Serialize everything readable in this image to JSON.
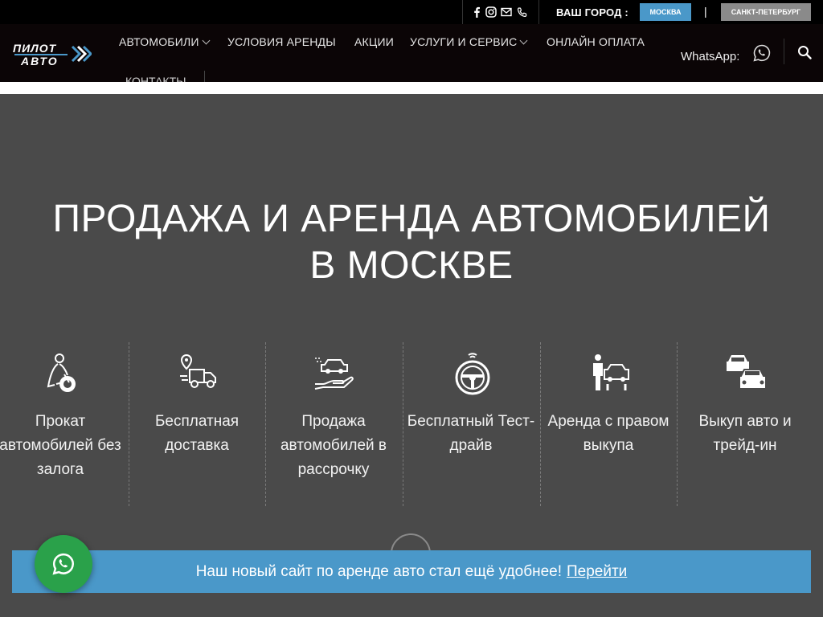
{
  "topbar": {
    "social_icons": [
      "facebook-icon",
      "instagram-icon",
      "mail-icon",
      "phone-icon"
    ],
    "city_label": "ВАШ ГОРОД :",
    "city_moscow": "МОСКВА",
    "city_divider": "|",
    "city_spb": "САНКТ-ПЕТЕРБУРГ"
  },
  "header": {
    "logo_line1": "ПИЛОТ",
    "logo_line2": "АВТО",
    "nav": [
      {
        "label": "АВТОМОБИЛИ",
        "dropdown": true
      },
      {
        "label": "УСЛОВИЯ АРЕНДЫ",
        "dropdown": false
      },
      {
        "label": "АКЦИИ",
        "dropdown": false
      },
      {
        "label": "УСЛУГИ И СЕРВИС",
        "dropdown": true
      },
      {
        "label": "ОНЛАЙН ОПЛАТА",
        "dropdown": false
      },
      {
        "label": "КОНТАКТЫ",
        "dropdown": false
      }
    ],
    "whatsapp_label": "WhatsApp:"
  },
  "hero": {
    "title_line1": "ПРОДАЖА И АРЕНДА АВТОМОБИЛЕЙ",
    "title_line2": "В МОСКВЕ",
    "features": [
      {
        "icon": "driver-icon",
        "text": "Прокат автомобилей без залога"
      },
      {
        "icon": "delivery-truck-icon",
        "text": "Бесплатная доставка"
      },
      {
        "icon": "car-in-hand-icon",
        "text": "Продажа автомобилей в рассрочку"
      },
      {
        "icon": "steering-wheel-icon",
        "text": "Бесплатный Тест-драйв"
      },
      {
        "icon": "person-with-car-icon",
        "text": "Аренда с правом выкупа"
      },
      {
        "icon": "two-cars-icon",
        "text": "Выкуп авто и трейд-ин"
      }
    ]
  },
  "notice": {
    "text": "Наш новый сайт по аренде авто стал ещё удобнее!",
    "link": "Перейти"
  },
  "colors": {
    "accent": "#4a98c9",
    "whatsapp_green": "#2aa14a",
    "hero_bg": "#4a4a4a",
    "header_bg": "#0b0506"
  }
}
